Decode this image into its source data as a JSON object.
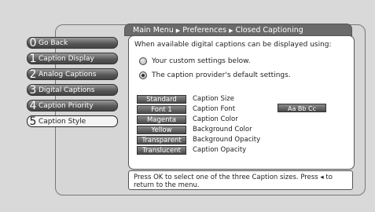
{
  "breadcrumb": {
    "items": [
      "Main Menu",
      "Preferences",
      "Closed Captioning"
    ]
  },
  "sidebar": {
    "items": [
      {
        "num": "0",
        "label": "Go Back"
      },
      {
        "num": "1",
        "label": "Caption Display"
      },
      {
        "num": "2",
        "label": "Analog Captions"
      },
      {
        "num": "3",
        "label": "Digital Captions"
      },
      {
        "num": "4",
        "label": "Caption Priority"
      },
      {
        "num": "5",
        "label": "Caption Style"
      }
    ],
    "selected_index": 5
  },
  "panel": {
    "heading": "When available digital captions can be displayed using:",
    "options": [
      {
        "label": "Your custom settings below.",
        "selected": false
      },
      {
        "label": "The caption provider's default settings.",
        "selected": true
      }
    ],
    "settings": [
      {
        "value": "Standard",
        "label": "Caption Size"
      },
      {
        "value": "Font 1",
        "label": "Caption Font"
      },
      {
        "value": "Magenta",
        "label": "Caption Color"
      },
      {
        "value": "Yellow",
        "label": "Background Color"
      },
      {
        "value": "Transparent",
        "label": "Background Opacity"
      },
      {
        "value": "Translucent",
        "label": "Caption Opacity"
      }
    ],
    "preview_text": "Aa Bb Cc"
  },
  "help": {
    "text": "Press OK to select one of the three Caption sizes. Press ◂ to return to the menu."
  }
}
